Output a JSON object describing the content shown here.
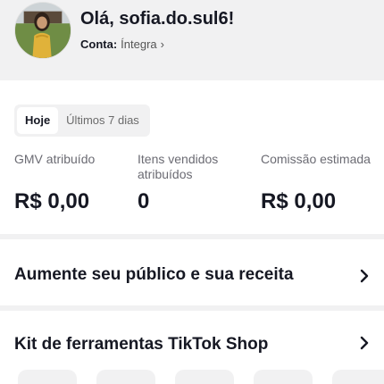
{
  "header": {
    "greeting": "Olá, sofia.do.sul6!",
    "account_label": "Conta:",
    "account_value": "Íntegra",
    "account_chevron": "›"
  },
  "stats": {
    "tabs": [
      {
        "label": "Hoje",
        "active": true
      },
      {
        "label": "Últimos 7 dias",
        "active": false
      }
    ],
    "metrics": [
      {
        "label": "GMV atribuído",
        "value": "R$ 0,00"
      },
      {
        "label": "Itens vendidos atribuídos",
        "value": "0"
      },
      {
        "label": "Comissão estimada",
        "value": "R$ 0,00"
      }
    ]
  },
  "grow": {
    "title": "Aumente seu público e sua receita"
  },
  "kit": {
    "title": "Kit de ferramentas TikTok Shop"
  },
  "icons": {
    "avatar": "avatar",
    "chevron": "chevron-right-icon"
  },
  "colors": {
    "background": "#f1f1f2",
    "card": "#ffffff",
    "text": "#161823",
    "muted": "#6b6b73"
  }
}
